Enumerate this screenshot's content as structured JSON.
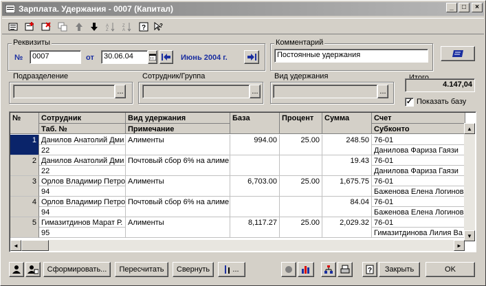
{
  "window": {
    "title": "Зарплата. Удержания - 0007 (Капитал)"
  },
  "groups": {
    "rekvizity": "Реквизиты",
    "comment": "Комментарий",
    "podrazd": "Подразделение",
    "sotrudnik": "Сотрудник/Группа",
    "vid": "Вид удержания",
    "itogo": "Итого"
  },
  "form": {
    "num_label": "№",
    "num_value": "0007",
    "date_label": "от",
    "date_value": "30.06.04",
    "period": "Июнь 2004 г.",
    "comment_value": "Постоянные удержания",
    "total": "4.147,04",
    "show_base_label": "Показать базу",
    "show_base_checked": "✓",
    "ellipsis": "..."
  },
  "table": {
    "headers_top": [
      "№",
      "Сотрудник",
      "Вид удержания",
      "База",
      "Процент",
      "Сумма",
      "Счет"
    ],
    "headers_bottom": [
      "Таб. №",
      "Примечание",
      "Субконто"
    ],
    "rows": [
      {
        "n": "1",
        "emp": "Данилов Анатолий Дми",
        "tab": "22",
        "vid": "Алименты",
        "base": "994.00",
        "pct": "25.00",
        "sum": "248.50",
        "acc": "76-01",
        "sub": "Данилова Фариза Гаязи"
      },
      {
        "n": "2",
        "emp": "Данилов Анатолий Дми",
        "tab": "22",
        "vid": "Почтовый сбор 6% на алиме",
        "base": "",
        "pct": "",
        "sum": "19.43",
        "acc": "76-01",
        "sub": "Данилова Фариза Гаязи"
      },
      {
        "n": "3",
        "emp": "Орлов Владимир Петро",
        "tab": "94",
        "vid": "Алименты",
        "base": "6,703.00",
        "pct": "25.00",
        "sum": "1,675.75",
        "acc": "76-01",
        "sub": "Баженова Елена Логинов"
      },
      {
        "n": "4",
        "emp": "Орлов Владимир Петро",
        "tab": "94",
        "vid": "Почтовый сбор 6% на алиме",
        "base": "",
        "pct": "",
        "sum": "84.04",
        "acc": "76-01",
        "sub": "Баженова Елена Логинов"
      },
      {
        "n": "5",
        "emp": "Гимазитдинов Марат Р.",
        "tab": "95",
        "vid": "Алименты",
        "base": "8,117.27",
        "pct": "25.00",
        "sum": "2,029.32",
        "acc": "76-01",
        "sub": "Гимазитдинова Лилия Ва"
      }
    ]
  },
  "buttons": {
    "form": "Сформировать...",
    "recalc": "Пересчитать",
    "collapse": "Свернуть",
    "close": "Закрыть",
    "ok": "OK",
    "tools": "..."
  },
  "colors": {
    "accent": "#1a2ea0",
    "selection": "#0a246a"
  }
}
